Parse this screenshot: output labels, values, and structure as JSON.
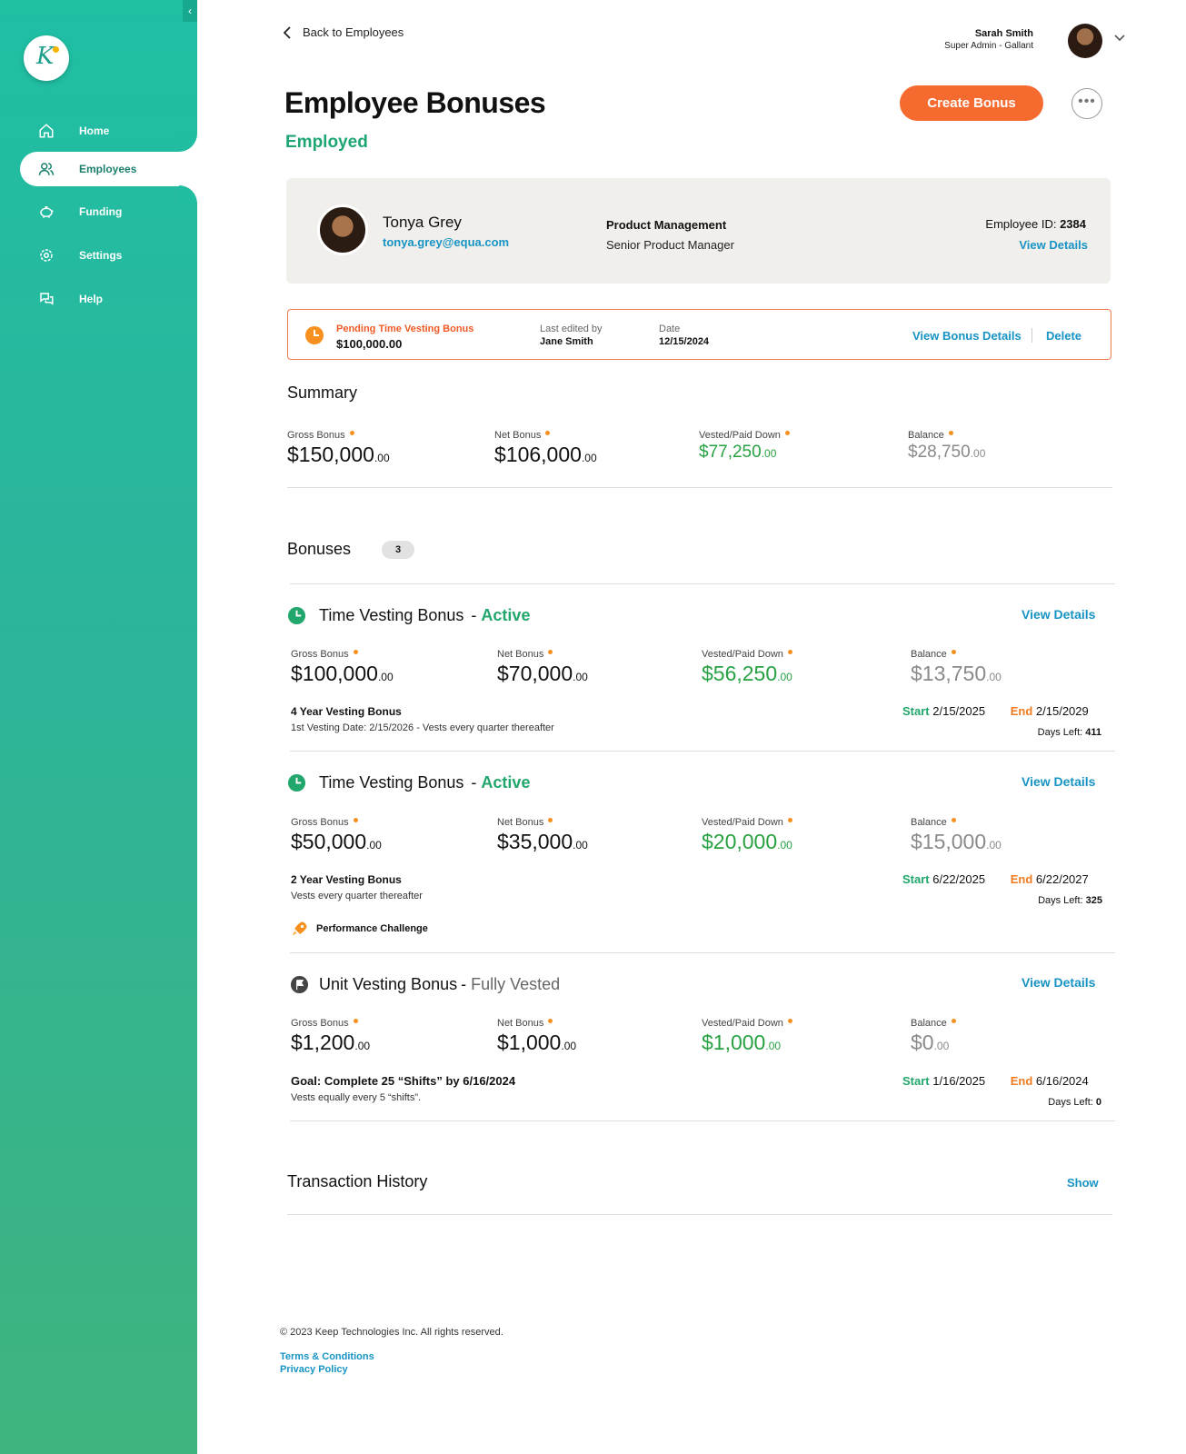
{
  "sidebar": {
    "items": [
      {
        "label": "Home",
        "icon": "home-icon"
      },
      {
        "label": "Employees",
        "icon": "users-icon"
      },
      {
        "label": "Funding",
        "icon": "piggy-bank-icon"
      },
      {
        "label": "Settings",
        "icon": "gear-icon"
      },
      {
        "label": "Help",
        "icon": "chat-icon"
      }
    ],
    "active": "Employees",
    "logo_letter": "K"
  },
  "header": {
    "back_label": "Back to Employees",
    "user_name": "Sarah Smith",
    "user_role": "Super Admin - Gallant"
  },
  "page": {
    "title": "Employee Bonuses",
    "status": "Employed",
    "create_label": "Create Bonus",
    "more_label": "•••"
  },
  "employee": {
    "name": "Tonya Grey",
    "email": "tonya.grey@equa.com",
    "department": "Product Management",
    "position": "Senior Product Manager",
    "id_label": "Employee ID: ",
    "id": "2384",
    "view_label": "View Details"
  },
  "pending": {
    "label": "Pending Time Vesting Bonus",
    "amount": "$100,000.00",
    "edited_label": "Last edited by",
    "edited_by": "Jane Smith",
    "date_label": "Date",
    "date": "12/15/2024",
    "view_label": "View Bonus Details",
    "delete_label": "Delete"
  },
  "summary": {
    "title": "Summary",
    "gross_label": "Gross Bonus",
    "gross": "$150,000",
    "gross_c": ".00",
    "net_label": "Net Bonus",
    "net": "$106,000",
    "net_c": ".00",
    "vested_label": "Vested/Paid Down",
    "vested": "$77,250",
    "vested_c": ".00",
    "balance_label": "Balance",
    "balance": "$28,750",
    "balance_c": ".00"
  },
  "bonuses": {
    "title": "Bonuses",
    "count": "3",
    "items": [
      {
        "type": "Time Vesting Bonus",
        "dash": "-",
        "status": "Active",
        "view": "View Details",
        "gross_label": "Gross Bonus",
        "gross": "$100,000",
        "gross_c": ".00",
        "net_label": "Net Bonus",
        "net": "$70,000",
        "net_c": ".00",
        "vested_label": "Vested/Paid Down",
        "vested": "$56,250",
        "vested_c": ".00",
        "balance_label": "Balance",
        "balance": "$13,750",
        "balance_c": ".00",
        "name": "4 Year Vesting Bonus",
        "desc": "1st Vesting Date: 2/15/2026  - Vests every quarter thereafter",
        "start_label": "Start",
        "start": "2/15/2025",
        "end_label": "End",
        "end": "2/15/2029",
        "days_label": "Days Left: ",
        "days": "411"
      },
      {
        "type": "Time Vesting Bonus",
        "dash": "-",
        "status": "Active",
        "view": "View Details",
        "gross_label": "Gross Bonus",
        "gross": "$50,000",
        "gross_c": ".00",
        "net_label": "Net Bonus",
        "net": "$35,000",
        "net_c": ".00",
        "vested_label": "Vested/Paid Down",
        "vested": "$20,000",
        "vested_c": ".00",
        "balance_label": "Balance",
        "balance": "$15,000",
        "balance_c": ".00",
        "name": "2 Year Vesting Bonus",
        "desc": "Vests every quarter thereafter",
        "start_label": "Start",
        "start": "6/22/2025",
        "end_label": "End",
        "end": "6/22/2027",
        "days_label": "Days Left: ",
        "days": "325",
        "extra": "Performance Challenge"
      },
      {
        "type": "Unit Vesting Bonus",
        "dash": "-",
        "status": "Fully Vested",
        "view": "View Details",
        "gross_label": "Gross Bonus",
        "gross": "$1,200",
        "gross_c": ".00",
        "net_label": "Net Bonus",
        "net": "$1,000",
        "net_c": ".00",
        "vested_label": "Vested/Paid Down",
        "vested": "$1,000",
        "vested_c": ".00",
        "balance_label": "Balance",
        "balance": "$0",
        "balance_c": ".00",
        "name": "Goal: Complete 25 “Shifts” by 6/16/2024",
        "desc": "Vests equally every 5 “shifts”.",
        "start_label": "Start",
        "start": "1/16/2025",
        "end_label": "End",
        "end": "6/16/2024",
        "days_label": "Days Left: ",
        "days": "0"
      }
    ]
  },
  "transactions": {
    "title": "Transaction History",
    "show_label": "Show"
  },
  "footer": {
    "copyright": "© 2023 Keep Technologies Inc. All rights reserved.",
    "terms": "Terms & Conditions",
    "privacy": "Privacy Policy"
  },
  "colors": {
    "accent": "#1fbfa4",
    "orange": "#f56a2e",
    "link": "#1793c4",
    "green": "#27a142"
  }
}
